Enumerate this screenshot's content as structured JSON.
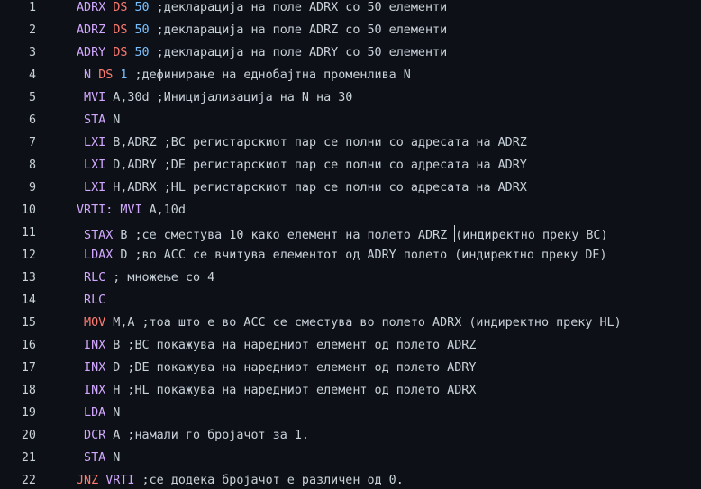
{
  "editor": {
    "lines": [
      {
        "no": "1",
        "tokens": [
          {
            "t": "ADRX",
            "c": "label"
          },
          {
            "t": " ",
            "c": "arg"
          },
          {
            "t": "DS",
            "c": "dir"
          },
          {
            "t": " ",
            "c": "arg"
          },
          {
            "t": "50",
            "c": "num"
          },
          {
            "t": " ;декларација на поле ADRX со 50 елементи",
            "c": "cmt"
          }
        ]
      },
      {
        "no": "2",
        "tokens": [
          {
            "t": "ADRZ",
            "c": "label"
          },
          {
            "t": " ",
            "c": "arg"
          },
          {
            "t": "DS",
            "c": "dir"
          },
          {
            "t": " ",
            "c": "arg"
          },
          {
            "t": "50",
            "c": "num"
          },
          {
            "t": " ;декларација на поле ADRZ со 50 елементи",
            "c": "cmt"
          }
        ]
      },
      {
        "no": "3",
        "tokens": [
          {
            "t": "ADRY",
            "c": "label"
          },
          {
            "t": " ",
            "c": "arg"
          },
          {
            "t": "DS",
            "c": "dir"
          },
          {
            "t": " ",
            "c": "arg"
          },
          {
            "t": "50",
            "c": "num"
          },
          {
            "t": " ;декларација на поле ADRY со 50 елементи",
            "c": "cmt"
          }
        ]
      },
      {
        "no": "4",
        "tokens": [
          {
            "t": " N",
            "c": "label"
          },
          {
            "t": " ",
            "c": "arg"
          },
          {
            "t": "DS",
            "c": "dir"
          },
          {
            "t": " ",
            "c": "arg"
          },
          {
            "t": "1",
            "c": "num"
          },
          {
            "t": " ;дефинирање на еднобајтна променлива N",
            "c": "cmt"
          }
        ]
      },
      {
        "no": "5",
        "tokens": [
          {
            "t": " MVI",
            "c": "op"
          },
          {
            "t": " A,30d ;Иницијализација на N на 30",
            "c": "arg"
          }
        ]
      },
      {
        "no": "6",
        "tokens": [
          {
            "t": " STA",
            "c": "op"
          },
          {
            "t": " N",
            "c": "arg"
          }
        ]
      },
      {
        "no": "7",
        "tokens": [
          {
            "t": " LXI",
            "c": "op"
          },
          {
            "t": " B,ADRZ ;BC регистарскиот пар се полни со адресата на ADRZ",
            "c": "arg"
          }
        ]
      },
      {
        "no": "8",
        "tokens": [
          {
            "t": " LXI",
            "c": "op"
          },
          {
            "t": " D,ADRY ;DE регистарскиот пар се полни со адресата на ADRY",
            "c": "arg"
          }
        ]
      },
      {
        "no": "9",
        "tokens": [
          {
            "t": " LXI",
            "c": "op"
          },
          {
            "t": " H,ADRX ;HL регистарскиот пар се полни со адресата на ADRX",
            "c": "arg"
          }
        ]
      },
      {
        "no": "10",
        "tokens": [
          {
            "t": "VRTI:",
            "c": "label"
          },
          {
            "t": " ",
            "c": "arg"
          },
          {
            "t": "MVI",
            "c": "op"
          },
          {
            "t": " A,10d",
            "c": "arg"
          }
        ]
      },
      {
        "no": "11",
        "tokens": [
          {
            "t": " STAX",
            "c": "op"
          },
          {
            "t": " B ;се сместува 10 како елемент на полето ADRZ ",
            "c": "arg"
          },
          {
            "t": "",
            "c": "caret"
          },
          {
            "t": "(индиректно преку BC)",
            "c": "arg"
          }
        ]
      },
      {
        "no": "12",
        "tokens": [
          {
            "t": " LDAX",
            "c": "op"
          },
          {
            "t": " D ;во ACC се вчитува елементот од ADRY полето (индиректно преку DE)",
            "c": "arg"
          }
        ]
      },
      {
        "no": "13",
        "tokens": [
          {
            "t": " RLC",
            "c": "op"
          },
          {
            "t": " ; множење со 4",
            "c": "arg"
          }
        ]
      },
      {
        "no": "14",
        "tokens": [
          {
            "t": " RLC",
            "c": "op"
          }
        ]
      },
      {
        "no": "15",
        "tokens": [
          {
            "t": " MOV",
            "c": "mov"
          },
          {
            "t": " M,A ;тоа што е во ACC се сместува во полето ADRX (индиректно преку HL)",
            "c": "arg"
          }
        ]
      },
      {
        "no": "16",
        "tokens": [
          {
            "t": " INX",
            "c": "op"
          },
          {
            "t": " B ;BC покажува на наредниот елемент од полето ADRZ",
            "c": "arg"
          }
        ]
      },
      {
        "no": "17",
        "tokens": [
          {
            "t": " INX",
            "c": "op"
          },
          {
            "t": " D ;DE покажува на наредниот елемент од полето ADRY",
            "c": "arg"
          }
        ]
      },
      {
        "no": "18",
        "tokens": [
          {
            "t": " INX",
            "c": "op"
          },
          {
            "t": " H ;HL покажува на наредниот елемент од полето ADRX",
            "c": "arg"
          }
        ]
      },
      {
        "no": "19",
        "tokens": [
          {
            "t": " LDA",
            "c": "op"
          },
          {
            "t": " N",
            "c": "arg"
          }
        ]
      },
      {
        "no": "20",
        "tokens": [
          {
            "t": " DCR",
            "c": "op"
          },
          {
            "t": " A ;намали го бројачот за 1.",
            "c": "arg"
          }
        ]
      },
      {
        "no": "21",
        "tokens": [
          {
            "t": " STA",
            "c": "op"
          },
          {
            "t": " N",
            "c": "arg"
          }
        ]
      },
      {
        "no": "22",
        "tokens": [
          {
            "t": "JNZ",
            "c": "jnz"
          },
          {
            "t": " ",
            "c": "arg"
          },
          {
            "t": "VRTI",
            "c": "label"
          },
          {
            "t": " ;се додека бројачот е различен од 0.",
            "c": "arg"
          }
        ]
      }
    ],
    "colors": {
      "background": "#0d1117",
      "text": "#c9d1d9",
      "label": "#d2a8ff",
      "directive": "#ff7b72",
      "number": "#79c0ff"
    }
  }
}
